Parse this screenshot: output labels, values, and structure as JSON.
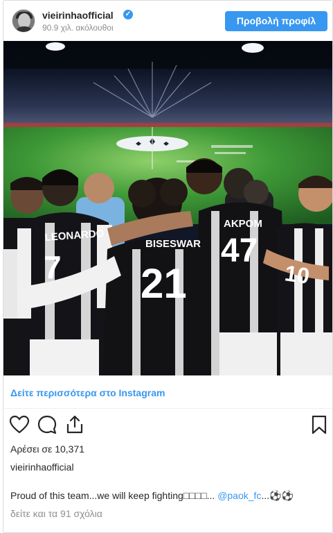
{
  "header": {
    "username": "vieirinhaofficial",
    "verified_mark": "✓",
    "followers": "90.9 χιλ. ακόλουθοι",
    "profile_button": "Προβολή προφίλ"
  },
  "photo": {
    "players": [
      {
        "name": "LEONARDO",
        "number": "7"
      },
      {
        "name": "BISESWAR",
        "number": "21"
      },
      {
        "name": "AKPOM",
        "number": "47"
      },
      {
        "name": "",
        "number": "10"
      }
    ]
  },
  "more_link": "Δείτε περισσότερα στο Instagram",
  "actions": {
    "like": "heart-icon",
    "comment": "comment-icon",
    "share": "share-icon",
    "save": "bookmark-icon"
  },
  "likes": "Αρέσει σε 10,371",
  "caption": {
    "username": "vieirinhaofficial",
    "text": "Proud of this team...we will keep fighting□□□□... ",
    "mention": "@paok_fc",
    "suffix": "...⚽⚽"
  },
  "comments_link": "δείτε και τα 91 σχόλια",
  "colors": {
    "accent": "#3897f0",
    "text": "#262626",
    "muted": "#8e8e8e"
  }
}
